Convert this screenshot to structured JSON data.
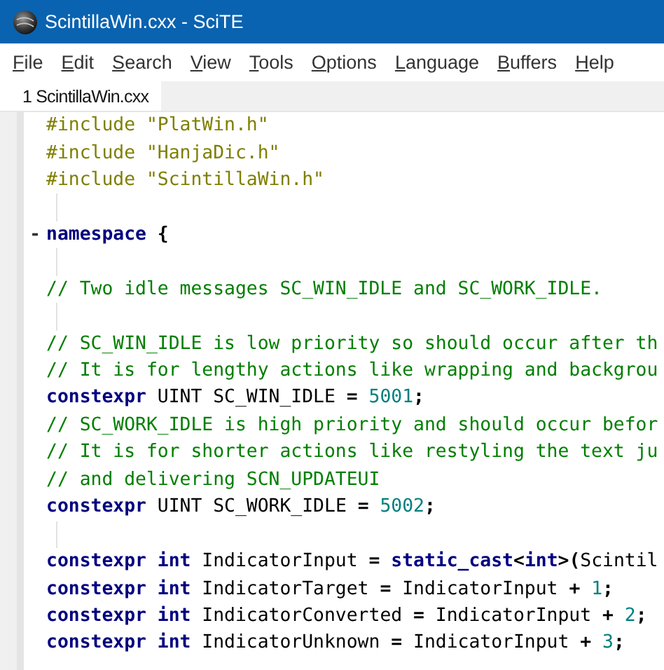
{
  "window": {
    "title": "ScintillaWin.cxx - SciTE"
  },
  "menu": [
    {
      "label": "File",
      "accelerator_underlined": true
    },
    {
      "label": "Edit",
      "accelerator_underlined": true
    },
    {
      "label": "Search",
      "accelerator_underlined": true
    },
    {
      "label": "View",
      "accelerator_underlined": true
    },
    {
      "label": "Tools",
      "accelerator_underlined": true
    },
    {
      "label": "Options",
      "accelerator_underlined": true
    },
    {
      "label": "Language",
      "accelerator_underlined": true
    },
    {
      "label": "Buffers",
      "accelerator_underlined": true
    },
    {
      "label": "Help",
      "accelerator_underlined": true
    }
  ],
  "tabs": [
    {
      "label": "1 ScintillaWin.cxx",
      "selected": true
    }
  ],
  "editor": {
    "lines": [
      {
        "tokens": [
          {
            "kind": "preprocessor",
            "text": "#include \"PlatWin.h\""
          }
        ]
      },
      {
        "tokens": [
          {
            "kind": "preprocessor",
            "text": "#include \"HanjaDic.h\""
          }
        ]
      },
      {
        "tokens": [
          {
            "kind": "preprocessor",
            "text": "#include \"ScintillaWin.h\""
          }
        ]
      },
      {
        "kind": "blank"
      },
      {
        "fold_marker": "-",
        "tokens": [
          {
            "kind": "keyword",
            "text": "namespace"
          },
          {
            "kind": "operator",
            "text": " {"
          }
        ]
      },
      {
        "kind": "blank"
      },
      {
        "tokens": [
          {
            "kind": "comment",
            "text": "// Two idle messages SC_WIN_IDLE and SC_WORK_IDLE."
          }
        ]
      },
      {
        "kind": "blank"
      },
      {
        "tokens": [
          {
            "kind": "comment",
            "text": "// SC_WIN_IDLE is low priority so should occur after th"
          }
        ]
      },
      {
        "tokens": [
          {
            "kind": "comment",
            "text": "// It is for lengthy actions like wrapping and backgrou"
          }
        ]
      },
      {
        "tokens": [
          {
            "kind": "keyword",
            "text": "constexpr"
          },
          {
            "kind": "plain",
            "text": " UINT SC_WIN_IDLE "
          },
          {
            "kind": "operator",
            "text": "= "
          },
          {
            "kind": "number",
            "text": "5001"
          },
          {
            "kind": "operator",
            "text": ";"
          }
        ]
      },
      {
        "tokens": [
          {
            "kind": "comment",
            "text": "// SC_WORK_IDLE is high priority and should occur befor"
          }
        ]
      },
      {
        "tokens": [
          {
            "kind": "comment",
            "text": "// It is for shorter actions like restyling the text ju"
          }
        ]
      },
      {
        "tokens": [
          {
            "kind": "comment",
            "text": "// and delivering SCN_UPDATEUI"
          }
        ]
      },
      {
        "tokens": [
          {
            "kind": "keyword",
            "text": "constexpr"
          },
          {
            "kind": "plain",
            "text": " UINT SC_WORK_IDLE "
          },
          {
            "kind": "operator",
            "text": "= "
          },
          {
            "kind": "number",
            "text": "5002"
          },
          {
            "kind": "operator",
            "text": ";"
          }
        ]
      },
      {
        "kind": "blank"
      },
      {
        "tokens": [
          {
            "kind": "keyword",
            "text": "constexpr int"
          },
          {
            "kind": "plain",
            "text": " IndicatorInput "
          },
          {
            "kind": "operator",
            "text": "= "
          },
          {
            "kind": "keyword",
            "text": "static_cast"
          },
          {
            "kind": "operator",
            "text": "<"
          },
          {
            "kind": "keyword",
            "text": "int"
          },
          {
            "kind": "operator",
            "text": ">("
          },
          {
            "kind": "plain",
            "text": "Scintil"
          }
        ]
      },
      {
        "tokens": [
          {
            "kind": "keyword",
            "text": "constexpr int"
          },
          {
            "kind": "plain",
            "text": " IndicatorTarget "
          },
          {
            "kind": "operator",
            "text": "="
          },
          {
            "kind": "plain",
            "text": " IndicatorInput "
          },
          {
            "kind": "operator",
            "text": "+ "
          },
          {
            "kind": "number",
            "text": "1"
          },
          {
            "kind": "operator",
            "text": ";"
          }
        ]
      },
      {
        "tokens": [
          {
            "kind": "keyword",
            "text": "constexpr int"
          },
          {
            "kind": "plain",
            "text": " IndicatorConverted "
          },
          {
            "kind": "operator",
            "text": "="
          },
          {
            "kind": "plain",
            "text": " IndicatorInput "
          },
          {
            "kind": "operator",
            "text": "+ "
          },
          {
            "kind": "number",
            "text": "2"
          },
          {
            "kind": "operator",
            "text": ";"
          }
        ]
      },
      {
        "tokens": [
          {
            "kind": "keyword",
            "text": "constexpr int"
          },
          {
            "kind": "plain",
            "text": " IndicatorUnknown "
          },
          {
            "kind": "operator",
            "text": "="
          },
          {
            "kind": "plain",
            "text": " IndicatorInput "
          },
          {
            "kind": "operator",
            "text": "+ "
          },
          {
            "kind": "number",
            "text": "3"
          },
          {
            "kind": "operator",
            "text": ";"
          }
        ]
      }
    ]
  }
}
